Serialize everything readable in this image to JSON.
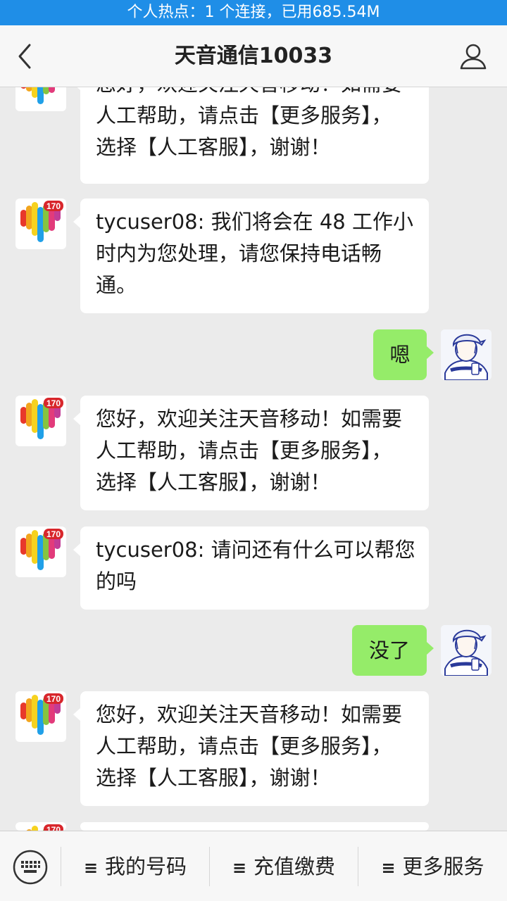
{
  "status_bar": {
    "text": "个人热点：1 个连接，已用685.54M"
  },
  "header": {
    "title": "天音通信10033"
  },
  "colors": {
    "status_bar": "#1f8ee7",
    "outgoing_bubble": "#95ec69",
    "incoming_bubble": "#ffffff",
    "background": "#ebebeb"
  },
  "avatar_badge": "170",
  "messages": [
    {
      "side": "in",
      "lines": [
        "您好，欢迎关注天音移动！如需要",
        "人工帮助，请点击【更多服务】，",
        "选择【人工客服】，谢谢！"
      ]
    },
    {
      "side": "in",
      "lines": [
        "tycuser08: 我们将会在 48 工作小",
        "时内为您处理，请您保持电话畅",
        "通。"
      ]
    },
    {
      "side": "out",
      "lines": [
        "嗯"
      ]
    },
    {
      "side": "in",
      "lines": [
        "您好，欢迎关注天音移动！如需要",
        "人工帮助，请点击【更多服务】，",
        "选择【人工客服】，谢谢！"
      ]
    },
    {
      "side": "in",
      "lines": [
        "tycuser08: 请问还有什么可以帮您",
        "的吗"
      ]
    },
    {
      "side": "out",
      "lines": [
        "没了"
      ]
    },
    {
      "side": "in",
      "lines": [
        "您好，欢迎关注天音移动！如需要",
        "人工帮助，请点击【更多服务】，",
        "选择【人工客服】，谢谢！"
      ]
    }
  ],
  "bottom_menu": {
    "keyboard_icon": "keyboard-icon",
    "items": [
      {
        "icon": "≡",
        "label": "我的号码"
      },
      {
        "icon": "≡",
        "label": "充值缴费"
      },
      {
        "icon": "≡",
        "label": "更多服务"
      }
    ]
  }
}
